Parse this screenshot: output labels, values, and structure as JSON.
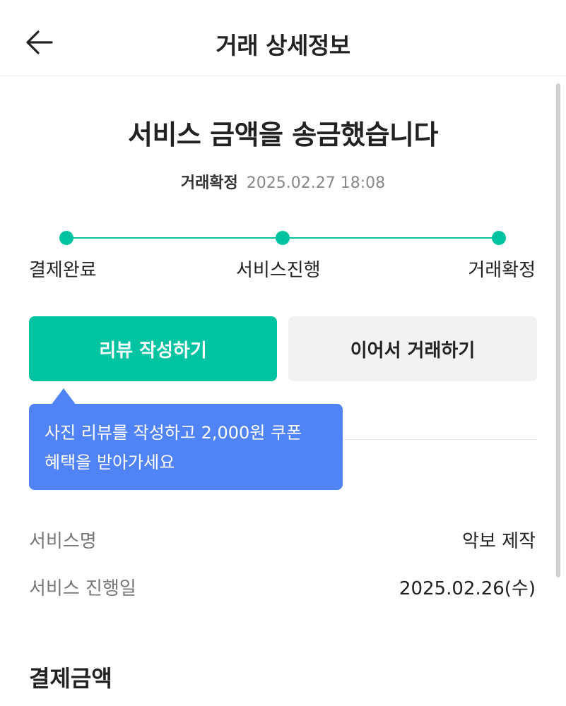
{
  "header": {
    "title": "거래 상세정보",
    "back_icon": "arrow-left-icon"
  },
  "summary": {
    "headline": "서비스 금액을 송금했습니다",
    "status_label": "거래확정",
    "status_datetime": "2025.02.27 18:08"
  },
  "progress": {
    "accent_color": "#00c4a1",
    "steps": [
      {
        "label": "결제완료"
      },
      {
        "label": "서비스진행"
      },
      {
        "label": "거래확정"
      }
    ]
  },
  "actions": {
    "review_label": "리뷰 작성하기",
    "continue_label": "이어서 거래하기"
  },
  "tooltip": {
    "line1": "사진 리뷰를 작성하고 2,000원 쿠폰",
    "line2": "혜택을 받아가세요",
    "color": "#5083f6"
  },
  "details": {
    "rows": [
      {
        "label": "서비스명",
        "value": "악보 제작"
      },
      {
        "label": "서비스 진행일",
        "value": "2025.02.26(수)"
      }
    ]
  },
  "payment": {
    "title": "결제금액"
  }
}
